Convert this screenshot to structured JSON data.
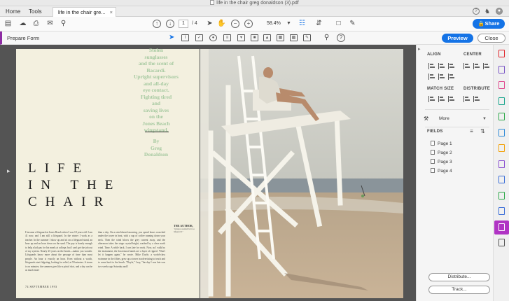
{
  "window": {
    "title": "life in the chair greg donaldson (3).pdf"
  },
  "tabs": {
    "home": "Home",
    "tools": "Tools",
    "document": "life in the chair gre...",
    "close": "×"
  },
  "toolbar": {
    "page_current": "1",
    "page_total": "/ 4",
    "zoom": "58.4%",
    "share_label": "Share",
    "icons": [
      "save-icon",
      "upload-icon",
      "print-icon",
      "email-icon",
      "search-icon",
      "page-up-icon",
      "page-down-icon",
      "select-cursor-icon",
      "hand-icon",
      "zoom-out-icon",
      "zoom-in-icon",
      "fit-icon",
      "scroll-mode-icon",
      "highlight-tool-icon",
      "comment-icon",
      "sign-icon"
    ]
  },
  "prepare_form": {
    "title": "Prepare Form",
    "preview_label": "Preview",
    "close_label": "Close",
    "field_tools": [
      "select-tool-icon",
      "text-field-icon",
      "checkbox-icon",
      "radio-button-icon",
      "list-box-icon",
      "dropdown-icon",
      "image-field-icon",
      "button-field-icon",
      "date-field-icon",
      "barcode-icon",
      "signature-field-icon",
      "pin-icon",
      "help-icon"
    ]
  },
  "document": {
    "pull_quote": "Stolen\nsunglasses\nand the scent of\nBacardi.\nUpright supervisors\nand all-day\neye contact.\nFighting tired\nand\nsaving lives\non the\nJones Beach\nwingstand.",
    "byline": "By\nGreg\nDonaldson",
    "headline_1": "LIFE",
    "headline_2": "IN THE",
    "headline_3": "CHAIR",
    "col1": "I became a lifeguard at Jones Beach when I was 18 years old. I am 41 now, and I am still a lifeguard. In the winter I work as a teacher. In the summer I show up and sit on a lifeguard stand, an hour up and an hour down on the sand. The pay is barely enough to help a kid pay for his meals at college, but I can't get the job out of my system. Nearly 25 years on the beach—makes you wonder. Lifeguards know more about the passage of time than most people. An hour is exactly an hour. Even without a watch, lifeguards start fidgeting, looking for relief, at 59 minutes. A storm is on minutes; the summer goes like a pistol shot, and a day can be as much more",
    "col2": "than a day. On a rain-blurred morning, you spend hours crouched under the tower in heat, with a cup of coffee running down your neck. Then the wind blows the grey current away, and the afternoon takes the stage crystal-bright, washed by a clear north wind. Time. A while back, I was late for work. Now, as I walk by the instrument, the lowermost bands are a layer of ripped. \"Don't let it happen again,\" he wrote. Mike Doyle, a world-class swimmer in the fifties, grew up a tower in advertising to teach and to come back to the beach. \"Doyle,\" I say, \"the day I was late was two weeks ago Saturday and I",
    "folio": "74  SEPTEMBER 1993",
    "caption_title": "THE AUTHOR,",
    "caption_text": "\"always wanted to be a lifeguard.\""
  },
  "right_panel": {
    "align_heading": "ALIGN",
    "center_heading": "CENTER",
    "match_size_heading": "MATCH SIZE",
    "distribute_heading": "DISTRIBUTE",
    "more_label": "More",
    "fields_heading": "FIELDS",
    "fields": [
      "Page 1",
      "Page 2",
      "Page 3",
      "Page 4"
    ],
    "distribute_button": "Distribute...",
    "track_button": "Track..."
  },
  "rail": {
    "icons": [
      {
        "name": "create-pdf-icon",
        "color": "#e0252b"
      },
      {
        "name": "combine-files-icon",
        "color": "#7a55c6"
      },
      {
        "name": "edit-pdf-icon",
        "color": "#e04b8f"
      },
      {
        "name": "export-pdf-icon",
        "color": "#1aa68e"
      },
      {
        "name": "export-excel-icon",
        "color": "#2fa94a"
      },
      {
        "name": "organize-pages-icon",
        "color": "#2f8bd8"
      },
      {
        "name": "comment-icon",
        "color": "#f2a20c"
      },
      {
        "name": "fill-sign-icon",
        "color": "#8a4fd0"
      },
      {
        "name": "measure-icon",
        "color": "#3c6fd8"
      },
      {
        "name": "send-for-review-icon",
        "color": "#2fa94a"
      },
      {
        "name": "protect-icon",
        "color": "#3c6fd8"
      },
      {
        "name": "prepare-form-icon",
        "color": "#b034c4"
      },
      {
        "name": "more-tools-icon",
        "color": "#555555"
      }
    ]
  },
  "colors": {
    "accent": "#1473e6",
    "form_accent": "#8e2ca3",
    "pull_quote": "#a6c9a0"
  }
}
